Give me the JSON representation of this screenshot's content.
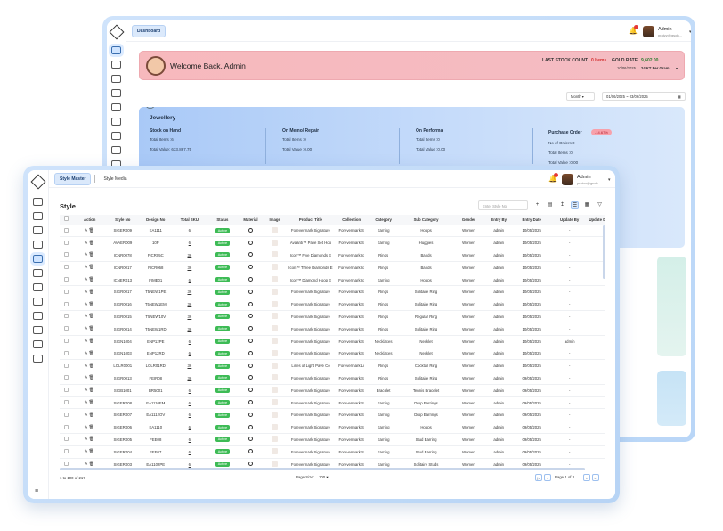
{
  "back": {
    "breadcrumb": "Dashboard",
    "user": {
      "name": "Admin",
      "email": "pratzz@gsoh..."
    },
    "welcome": "Welcome Back, Admin",
    "last_stock_label": "LAST STOCK COUNT",
    "last_stock_value": "0 Items",
    "gold_rate_label": "GOLD RATE",
    "gold_rate_value": "9,602.00",
    "gold_date": "10/06/2025",
    "gold_unit": "24 KT Per Gram",
    "period": "Month",
    "date_range": "01/06/2025 ~ 03/06/2025",
    "jewellery": {
      "title": "Jewellery",
      "stock_on_hand": {
        "title": "Stock on Hand",
        "items": "Total Items :6",
        "value": "Total Value: 633,867.75"
      },
      "on_memo": {
        "title": "On Memo/ Repair",
        "items": "Total Items :0",
        "value": "Total Value :0.00"
      },
      "on_performa": {
        "title": "On Performa",
        "items": "Total Items :0",
        "value": "Total Value :0.00"
      },
      "purchase_order": {
        "title": "Purchase Order",
        "pill": "-14.67%",
        "orders": "No of Orders:0",
        "items": "Total Items :0",
        "value": "Total Value :0.00"
      }
    }
  },
  "front": {
    "tabs": [
      "Style Master",
      "Style Media"
    ],
    "user": {
      "name": "Admin",
      "email": "pratzz@gsoh..."
    },
    "title": "Style",
    "search_placeholder": "Enter Style No",
    "columns": [
      "",
      "Action",
      "Style No",
      "Design No",
      "Total SKU",
      "Status",
      "Material",
      "Image",
      "Product Title",
      "Collection",
      "Category",
      "Sub Category",
      "Gender",
      "Entry By",
      "Entry Date",
      "Update By",
      "Update D"
    ],
    "rows": [
      [
        "SIGER009",
        "EA1111",
        "6",
        "Active",
        "Forevermark Signature",
        "Forevermark S",
        "Earring",
        "Hoops",
        "Women",
        "admin",
        "10/05/2025",
        "-"
      ],
      [
        "AVAER009",
        "10P",
        "6",
        "Active",
        "Avaanti™ Pavé Set Hoo",
        "Forevermark S",
        "Earring",
        "Huggies",
        "Women",
        "admin",
        "10/05/2025",
        "-"
      ],
      [
        "ICNR0078",
        "FICR05C",
        "36",
        "Active",
        "Icon™ Five Diamonds E",
        "Forevermark Ic",
        "Rings",
        "Bands",
        "Women",
        "admin",
        "10/05/2025",
        "-"
      ],
      [
        "ICNR0017",
        "FICR068",
        "36",
        "Active",
        "Icon™ Three Diamonds E",
        "Forevermark Ic",
        "Rings",
        "Bands",
        "Women",
        "admin",
        "10/05/2025",
        "-"
      ],
      [
        "ICNER013",
        "FIME01",
        "6",
        "Active",
        "Icon™ Diamond Hoop E",
        "Forevermark Ic",
        "Earring",
        "Hoops",
        "Women",
        "admin",
        "10/05/2025",
        "-"
      ],
      [
        "SIGR0017",
        "T5NEW1PE",
        "36",
        "Active",
        "Forevermark Signature",
        "Forevermark S",
        "Rings",
        "Solitaire Ring",
        "Women",
        "admin",
        "10/05/2025",
        "-"
      ],
      [
        "SIGR0016",
        "T5NEW1EM",
        "36",
        "Active",
        "Forevermark Signature",
        "Forevermark S",
        "Rings",
        "Solitaire Ring",
        "Women",
        "admin",
        "10/05/2025",
        "-"
      ],
      [
        "SIGR0015",
        "T5NEW10V",
        "36",
        "Active",
        "Forevermark Signature",
        "Forevermark S",
        "Rings",
        "Regular Ring",
        "Women",
        "admin",
        "10/05/2025",
        "-"
      ],
      [
        "SIGR0014",
        "T5NEW1RD",
        "36",
        "Active",
        "Forevermark Signature",
        "Forevermark S",
        "Rings",
        "Solitaire Ring",
        "Women",
        "admin",
        "10/05/2025",
        "-"
      ],
      [
        "SIGN1004",
        "ENP12PE",
        "6",
        "Active",
        "Forevermark Signature",
        "Forevermark S",
        "Necklaces",
        "Necklet",
        "Women",
        "admin",
        "10/05/2025",
        "admin"
      ],
      [
        "SIGN1003",
        "ENP12RD",
        "6",
        "Active",
        "Forevermark Signature",
        "Forevermark S",
        "Necklaces",
        "Necklet",
        "Women",
        "admin",
        "10/05/2025",
        "-"
      ],
      [
        "LOLR0001",
        "LOLR01RD",
        "36",
        "Active",
        "Lines of Light Pavé Co",
        "Forevermark Li",
        "Rings",
        "Cocktail Ring",
        "Women",
        "admin",
        "10/05/2025",
        "-"
      ],
      [
        "SIGR0013",
        "FEIR08",
        "36",
        "Active",
        "Forevermark Signature",
        "Forevermark S",
        "Rings",
        "Solitaire Ring",
        "Women",
        "admin",
        "09/05/2025",
        "-"
      ],
      [
        "SIGB1001",
        "BR5001",
        "6",
        "Active",
        "Forevermark Signature",
        "Forevermark S",
        "Bracelet",
        "Tennis Bracelet",
        "Women",
        "admin",
        "09/05/2025",
        "-"
      ],
      [
        "SIGER008",
        "EA1110EM",
        "6",
        "Active",
        "Forevermark Signature",
        "Forevermark S",
        "Earring",
        "Drop Earrings",
        "Women",
        "admin",
        "09/05/2025",
        "-"
      ],
      [
        "SIGER007",
        "EA1112OV",
        "6",
        "Active",
        "Forevermark Signature",
        "Forevermark S",
        "Earring",
        "Drop Earrings",
        "Women",
        "admin",
        "09/05/2025",
        "-"
      ],
      [
        "SIGER006",
        "EA1110",
        "6",
        "Active",
        "Forevermark Signature",
        "Forevermark S",
        "Earring",
        "Hoops",
        "Women",
        "admin",
        "09/05/2025",
        "-"
      ],
      [
        "SIGER005",
        "FEE08",
        "6",
        "Active",
        "Forevermark Signature",
        "Forevermark S",
        "Earring",
        "Stud Earring",
        "Women",
        "admin",
        "09/05/2025",
        "-"
      ],
      [
        "SIGER004",
        "FEE07",
        "6",
        "Active",
        "Forevermark Signature",
        "Forevermark S",
        "Earring",
        "Stud Earring",
        "Women",
        "admin",
        "09/05/2025",
        "-"
      ],
      [
        "SIGER003",
        "EA1102PE",
        "6",
        "Active",
        "Forevermark Signature",
        "Forevermark S",
        "Earring",
        "Solitaire Studs",
        "Women",
        "admin",
        "09/05/2025",
        "-"
      ]
    ],
    "footer_count": "1 to 100 of 217",
    "page_size_label": "Page Size:",
    "page_size_value": "100",
    "page_info": "Page 1 of 3"
  }
}
